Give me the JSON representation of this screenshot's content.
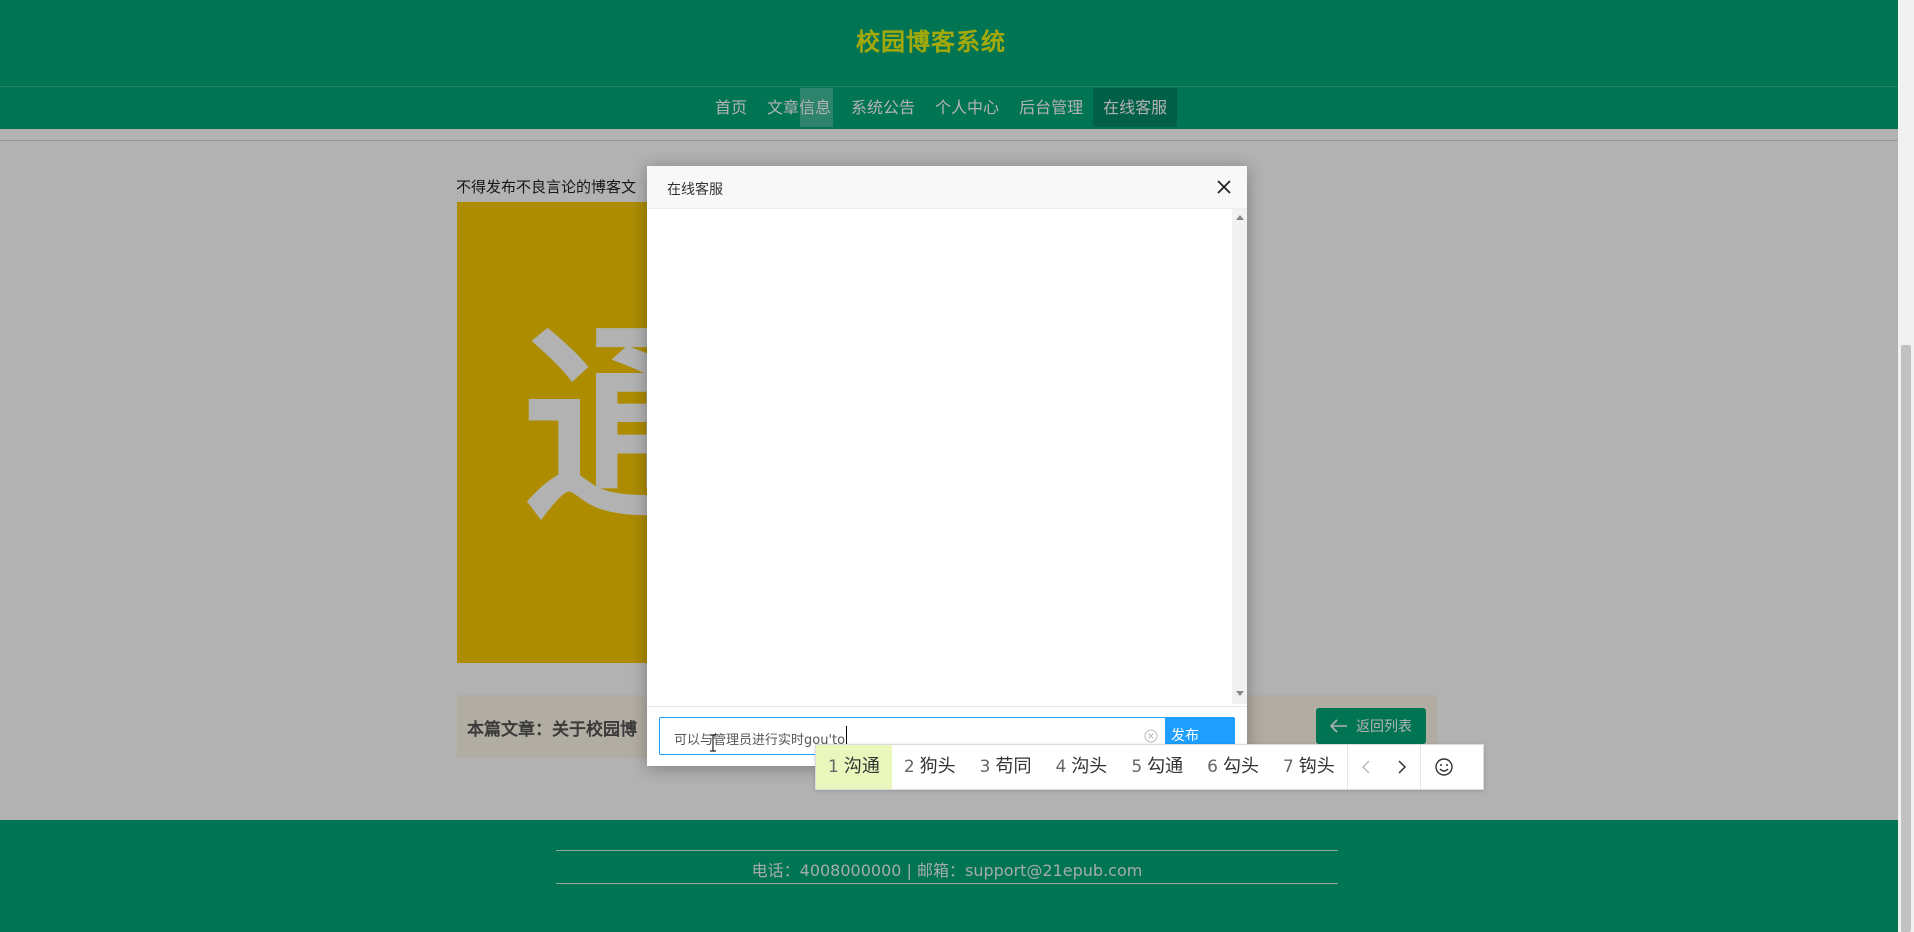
{
  "header": {
    "site_title": "校园博客系统",
    "nav": [
      "首页",
      "文章信息",
      "系统公告",
      "个人中心",
      "后台管理",
      "在线客服"
    ],
    "active_nav": "在线客服"
  },
  "content": {
    "notice": "不得发布不良言论的博客文",
    "poster_glyph": "通",
    "article_label": "本篇文章：关于校园博",
    "back_button": "返回列表"
  },
  "footer": {
    "info": "电话：4008000000 | 邮箱：support@21epub.com"
  },
  "dialog": {
    "title": "在线客服",
    "input_value": "可以与管理员进行实时gou'to",
    "send_button": "发布"
  },
  "ime": {
    "candidates": [
      {
        "num": "1",
        "text": "沟通"
      },
      {
        "num": "2",
        "text": "狗头"
      },
      {
        "num": "3",
        "text": "苟同"
      },
      {
        "num": "4",
        "text": "沟头"
      },
      {
        "num": "5",
        "text": "勾通"
      },
      {
        "num": "6",
        "text": "勾头"
      },
      {
        "num": "7",
        "text": "钩头"
      }
    ]
  },
  "colors": {
    "header_green": "#02a678",
    "title_yellow": "#eaf311",
    "poster_yellow": "#f8c900",
    "send_blue": "#1e9fff",
    "ime_highlight": "#e9f7bd"
  }
}
